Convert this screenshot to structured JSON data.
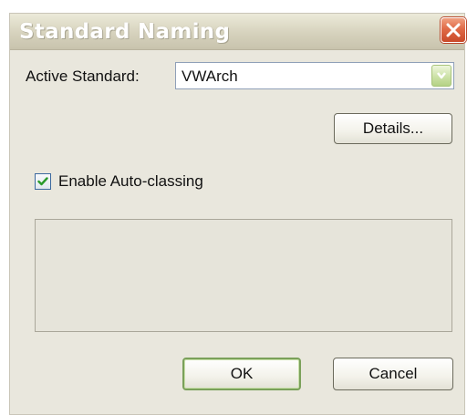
{
  "window": {
    "title": "Standard Naming"
  },
  "form": {
    "active_standard_label": "Active Standard:",
    "active_standard_value": "VWArch",
    "details_button": "Details...",
    "auto_classing_label": "Enable Auto-classing",
    "auto_classing_checked": true
  },
  "buttons": {
    "ok": "OK",
    "cancel": "Cancel"
  },
  "icons": {
    "close": "close-icon",
    "dropdown": "chevron-down-icon",
    "check": "checkmark-icon"
  },
  "colors": {
    "close_button": "#e06a47",
    "dropdown_button": "#c9e0a3",
    "checkmark": "#2a9a2a",
    "ok_border": "#7aa05a"
  }
}
